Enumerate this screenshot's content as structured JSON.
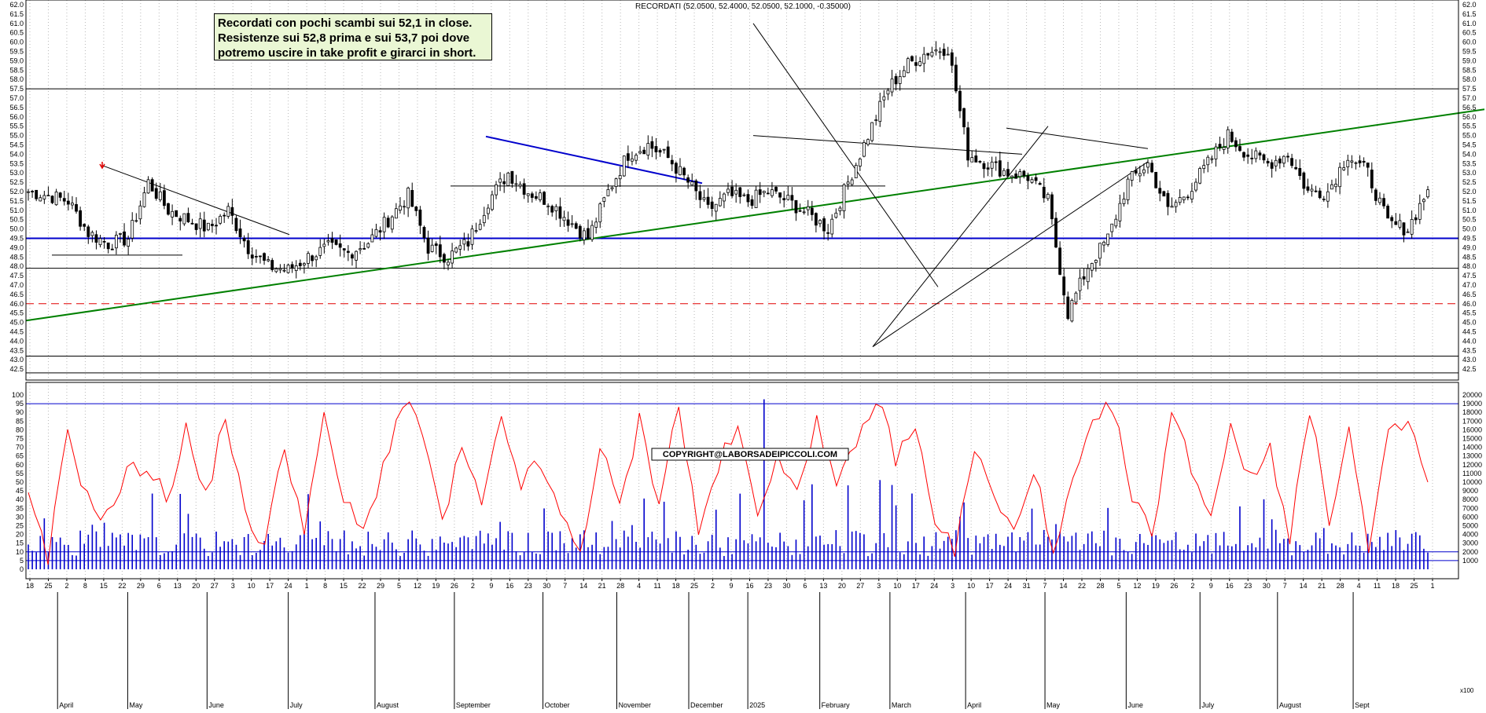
{
  "header": "RECORDATI (52.0500, 52.4000, 52.0500, 52.1000, -0.35000)",
  "notes": [
    "Recordati con pochi scambi sui 52,1 in close.",
    "Resistenze sui 52,8 prima e sui 53,7 poi dove",
    "potremo uscire in take profit e girarci in short."
  ],
  "copyright": "COPYRIGHT@LABORSADEIPICCOLI.COM",
  "volume_unit": "x100",
  "colors": {
    "background": "#ffffff",
    "candle": "#000000",
    "trend_green": "#008000",
    "trend_blue": "#0000cc",
    "support_red_dashed": "#e00000",
    "oscillator": "#ff0000",
    "volume": "#0000cc"
  },
  "chart_data": [
    {
      "type": "line",
      "name": "price",
      "x_label_days": [
        "18",
        "25",
        "2",
        "8",
        "15",
        "22",
        "29",
        "6",
        "13",
        "20",
        "27",
        "3",
        "10",
        "17",
        "24",
        "1",
        "8",
        "15",
        "22",
        "29",
        "5",
        "12",
        "19",
        "26",
        "2",
        "9",
        "16",
        "23",
        "30",
        "7",
        "14",
        "21",
        "28",
        "4",
        "11",
        "18",
        "25",
        "2",
        "9",
        "16",
        "23",
        "30",
        "6",
        "13",
        "20",
        "27",
        "3",
        "10",
        "17",
        "24",
        "3",
        "10",
        "17",
        "24",
        "31",
        "7",
        "14",
        "22",
        "28",
        "5",
        "12",
        "19",
        "26",
        "2",
        "9",
        "16",
        "23",
        "30",
        "7",
        "14",
        "21",
        "28",
        "4",
        "11",
        "18",
        "25",
        "1"
      ],
      "x_label_months": [
        "April",
        "May",
        "June",
        "July",
        "August",
        "September",
        "October",
        "November",
        "December",
        "2025",
        "February",
        "March",
        "April",
        "May",
        "June",
        "July",
        "August",
        "Sept"
      ],
      "y_ticks": [
        "42.5",
        "43.0",
        "43.5",
        "44.0",
        "44.5",
        "45.0",
        "45.5",
        "46.0",
        "46.5",
        "47.0",
        "47.5",
        "48.0",
        "48.5",
        "49.0",
        "49.5",
        "50.0",
        "50.5",
        "51.0",
        "51.5",
        "52.0",
        "52.5",
        "53.0",
        "53.5",
        "54.0",
        "54.5",
        "55.0",
        "55.5",
        "56.0",
        "56.5",
        "57.0",
        "57.5",
        "58.0",
        "58.5",
        "59.0",
        "59.5",
        "60.0",
        "60.5",
        "61.0",
        "61.5",
        "62.0"
      ],
      "ylim": [
        42.0,
        62.0
      ],
      "close_approx": [
        52.0,
        51.8,
        51.5,
        49.8,
        49.2,
        49.5,
        52.5,
        51.0,
        50.5,
        50.0,
        51.0,
        49.0,
        48.0,
        47.8,
        48.5,
        49.0,
        48.7,
        49.3,
        50.5,
        51.8,
        49.0,
        48.5,
        49.3,
        51.5,
        53.0,
        52.0,
        51.5,
        50.5,
        49.5,
        52.0,
        54.0,
        54.5,
        53.8,
        52.5,
        51.0,
        51.8,
        51.5,
        52.0,
        51.5,
        50.8,
        50.0,
        52.5,
        55.0,
        57.5,
        58.8,
        59.5,
        59.7,
        54.0,
        53.5,
        53.0,
        52.8,
        51.5,
        45.5,
        48.0,
        49.5,
        52.5,
        53.5,
        51.0,
        52.0,
        53.5,
        55.0,
        54.0,
        53.5,
        54.0,
        52.0,
        52.0,
        54.0,
        53.0,
        50.3,
        50.0,
        52.1
      ],
      "horizontal_levels": [
        57.5,
        49.5,
        47.9,
        46.0,
        43.2,
        42.3
      ],
      "trend_lines": [
        {
          "color": "green",
          "from": [
            45.1,
            "Apr"
          ],
          "to": [
            56.4,
            "Sept"
          ]
        },
        {
          "color": "blue",
          "from": [
            54.9,
            "Oct"
          ],
          "to": [
            52.4,
            "Dec"
          ]
        }
      ]
    },
    {
      "type": "line",
      "name": "oscillator",
      "y_ticks": [
        "0",
        "5",
        "10",
        "15",
        "20",
        "25",
        "30",
        "35",
        "40",
        "45",
        "50",
        "55",
        "60",
        "65",
        "70",
        "75",
        "80",
        "85",
        "90",
        "95",
        "100"
      ],
      "ylim": [
        0,
        100
      ],
      "reference_levels": [
        95,
        5
      ],
      "values_approx": [
        40,
        5,
        80,
        40,
        30,
        55,
        60,
        40,
        80,
        40,
        90,
        30,
        15,
        70,
        25,
        85,
        40,
        20,
        60,
        95,
        80,
        25,
        70,
        35,
        85,
        50,
        60,
        30,
        10,
        70,
        35,
        85,
        40,
        95,
        20,
        60,
        80,
        30,
        70,
        40,
        90,
        45,
        70,
        99,
        65,
        80,
        30,
        10,
        70,
        40,
        20,
        60,
        5,
        50,
        80,
        95,
        40,
        20,
        90,
        60,
        30,
        85,
        50,
        70,
        20,
        90,
        30,
        80,
        10,
        75,
        85,
        50
      ]
    },
    {
      "type": "bar",
      "name": "volume",
      "y_ticks": [
        "1000",
        "2000",
        "3000",
        "4000",
        "5000",
        "6000",
        "7000",
        "8000",
        "9000",
        "10000",
        "11000",
        "12000",
        "13000",
        "14000",
        "15000",
        "16000",
        "17000",
        "18000",
        "19000",
        "20000"
      ],
      "ylim": [
        0,
        20000
      ],
      "reference_level": 2000
    }
  ]
}
